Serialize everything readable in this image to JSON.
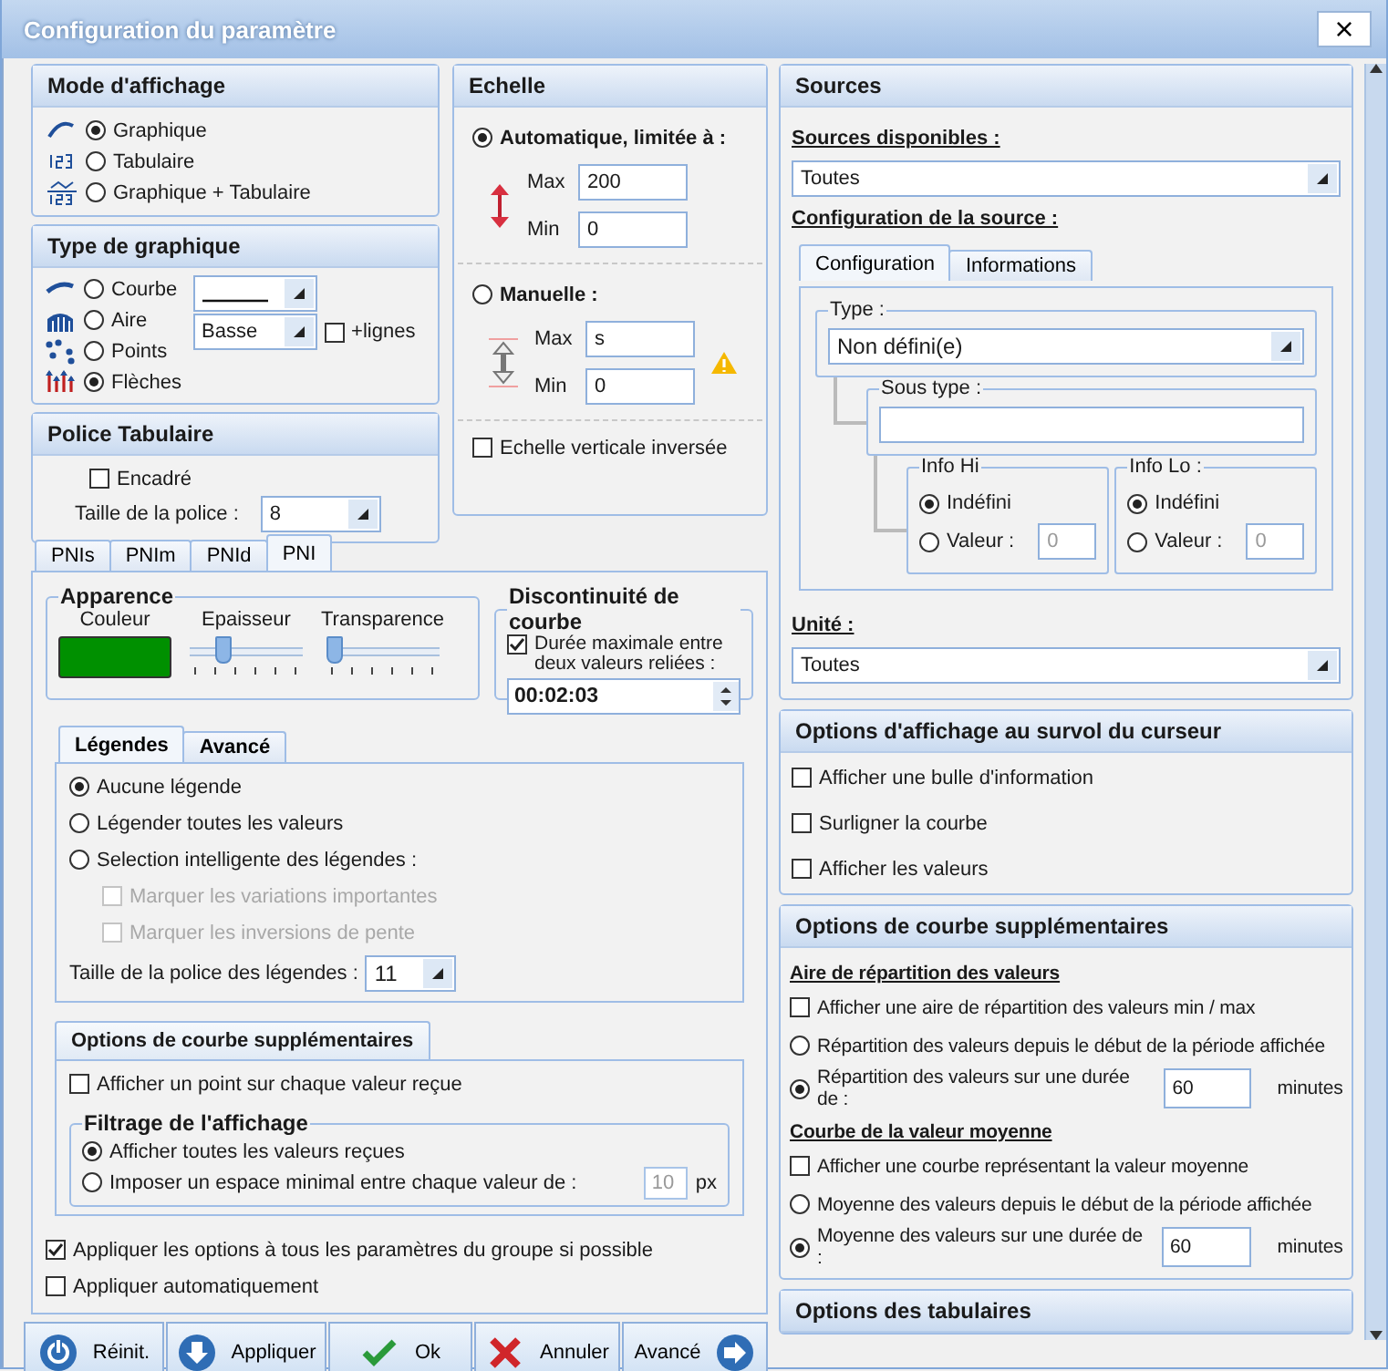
{
  "window": {
    "title": "Configuration du paramètre",
    "close": "×"
  },
  "display_mode": {
    "title": "Mode d'affichage",
    "options": [
      {
        "label": "Graphique",
        "selected": true
      },
      {
        "label": "Tabulaire",
        "selected": false
      },
      {
        "label": "Graphique + Tabulaire",
        "selected": false
      }
    ]
  },
  "chart_type": {
    "title": "Type de graphique",
    "options": [
      {
        "label": "Courbe",
        "selected": false
      },
      {
        "label": "Aire",
        "selected": false
      },
      {
        "label": "Points",
        "selected": false
      },
      {
        "label": "Flèches",
        "selected": true
      }
    ],
    "fill_select": "Basse",
    "lines_checkbox": {
      "label": "+lignes",
      "checked": false
    }
  },
  "table_font": {
    "title": "Police Tabulaire",
    "framed": {
      "label": "Encadré",
      "checked": false
    },
    "size_label": "Taille de la police :",
    "size": "8"
  },
  "scale": {
    "title": "Echelle",
    "auto": {
      "label": "Automatique, limitée à :",
      "selected": true,
      "max_label": "Max",
      "max": "200",
      "min_label": "Min",
      "min": "0"
    },
    "manual": {
      "label": "Manuelle :",
      "selected": false,
      "max_label": "Max",
      "max": "s",
      "min_label": "Min",
      "min": "0",
      "warning": true
    },
    "inverted": {
      "label": "Echelle verticale inversée",
      "checked": false
    }
  },
  "param_tabs": [
    {
      "label": "PNIs",
      "selected": false
    },
    {
      "label": "PNIm",
      "selected": false
    },
    {
      "label": "PNId",
      "selected": false
    },
    {
      "label": "PNI",
      "selected": true
    }
  ],
  "appearance": {
    "title": "Apparence",
    "color_label": "Couleur",
    "color": "#009000",
    "thickness_label": "Epaisseur",
    "thickness": {
      "level": 0.25
    },
    "transparency_label": "Transparence",
    "transparency": {
      "level": 0.04
    }
  },
  "discontinuity": {
    "title": "Discontinuité de courbe",
    "max_duration": {
      "label": "Durée maximale entre deux valeurs reliées :",
      "checked": true
    },
    "duration": "00:02:03"
  },
  "legend_tabs": [
    {
      "label": "Légendes",
      "selected": true
    },
    {
      "label": "Avancé",
      "selected": false
    }
  ],
  "legend_radios": [
    {
      "label": "Aucune légende",
      "selected": true
    },
    {
      "label": "Légender toutes les valeurs",
      "selected": false
    },
    {
      "label": "Selection intelligente des légendes :",
      "selected": false
    }
  ],
  "legend_marks": [
    {
      "label": "Marquer les variations importantes",
      "checked": false,
      "disabled": true
    },
    {
      "label": "Marquer les inversions de pente",
      "checked": false,
      "disabled": true
    }
  ],
  "legend_font": {
    "label": "Taille de la police des légendes :",
    "value": "11"
  },
  "curve_options": {
    "title": "Options de courbe supplémentaires",
    "point_each": {
      "label": "Afficher un point sur chaque valeur reçue",
      "checked": false
    },
    "filter": {
      "title": "Filtrage de l'affichage",
      "options": [
        {
          "label": "Afficher toutes les valeurs reçues",
          "selected": true
        },
        {
          "label": "Imposer un espace minimal entre chaque valeur de :",
          "selected": false
        }
      ],
      "min_space": "10",
      "min_space_disabled": true,
      "unit": "px"
    }
  },
  "apply_all": {
    "label": "Appliquer les options à tous les paramètres du groupe si possible",
    "checked": true
  },
  "auto_apply": {
    "label": "Appliquer automatiquement",
    "checked": false
  },
  "buttons": [
    {
      "label": "Réinit.",
      "kind": "reset"
    },
    {
      "label": "Appliquer",
      "kind": "apply"
    },
    {
      "label": "Ok",
      "kind": "ok"
    },
    {
      "label": "Annuler",
      "kind": "cancel"
    },
    {
      "label": "Avancé",
      "kind": "advanced"
    }
  ],
  "sources": {
    "title": "Sources",
    "available_label": "Sources disponibles :",
    "available": "Toutes",
    "config_label": "Configuration de la source :",
    "tabs": [
      {
        "label": "Configuration",
        "selected": true
      },
      {
        "label": "Informations",
        "selected": false
      }
    ],
    "type_label": "Type :",
    "type": "Non défini(e)",
    "subtype_label": "Sous type :",
    "info": [
      {
        "title": "Info Hi",
        "options": [
          {
            "label": "Indéfini",
            "selected": true
          },
          {
            "label": "Valeur :",
            "selected": false
          }
        ],
        "value": "0",
        "value_disabled": true
      },
      {
        "title": "Info Lo :",
        "options": [
          {
            "label": "Indéfini",
            "selected": true
          },
          {
            "label": "Valeur :",
            "selected": false
          }
        ],
        "value": "0",
        "value_disabled": true
      }
    ],
    "unit_label": "Unité :",
    "unit": "Toutes"
  },
  "hover_options": {
    "title": "Options d'affichage au survol du curseur",
    "items": [
      {
        "label": "Afficher une bulle d'information",
        "checked": false
      },
      {
        "label": "Surligner la courbe",
        "checked": false
      },
      {
        "label": "Afficher les valeurs",
        "checked": false
      }
    ]
  },
  "extra_options": {
    "title": "Options de courbe supplémentaires",
    "sections": [
      {
        "title": "Aire de répartition des valeurs",
        "checkbox": {
          "label": "Afficher une aire de répartition des valeurs min / max",
          "checked": false
        },
        "options": [
          {
            "label": "Répartition des valeurs depuis le début de la période affichée",
            "selected": false
          },
          {
            "label": "Répartition des valeurs sur une durée de :",
            "selected": true
          }
        ],
        "duration": "60",
        "unit": "minutes"
      },
      {
        "title": "Courbe de la valeur moyenne",
        "checkbox": {
          "label": "Afficher une courbe représentant la valeur moyenne",
          "checked": false
        },
        "options": [
          {
            "label": "Moyenne des valeurs depuis le début de la période affichée",
            "selected": false
          },
          {
            "label": "Moyenne des valeurs sur une durée de :",
            "selected": true
          }
        ],
        "duration": "60",
        "unit": "minutes"
      }
    ]
  },
  "tabular_options": {
    "title": "Options des tabulaires"
  }
}
